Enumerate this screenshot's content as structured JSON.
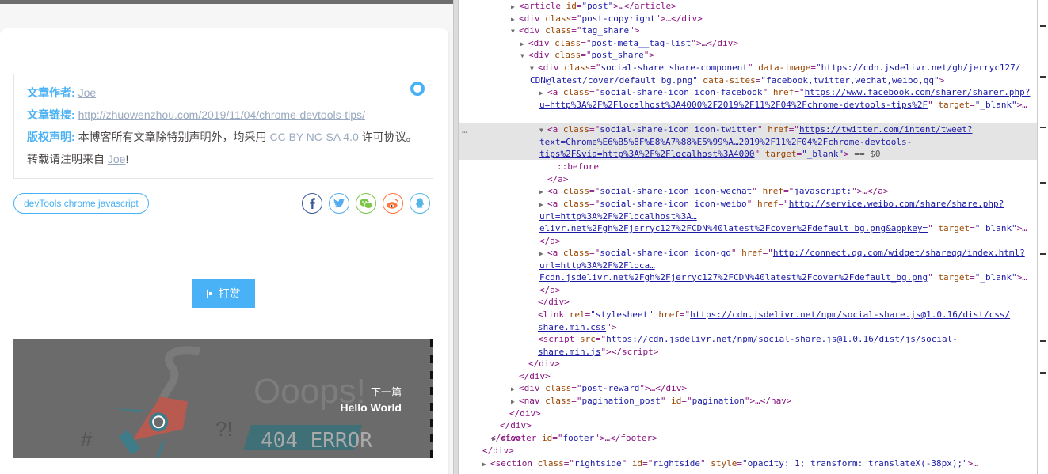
{
  "page": {
    "copyright": {
      "author_key": "文章作者:",
      "author_val": "Joe",
      "link_key": "文章链接:",
      "link_val": "http://zhuowenzhou.com/2019/11/04/chrome-devtools-tips/",
      "license_key": "版权声明:",
      "license_pre": "本博客所有文章除特别声明外，均采用",
      "license_link": "CC BY-NC-SA 4.0",
      "license_post": "许可协议。",
      "reprint_pre": "转载请注明来自",
      "reprint_link": "Joe",
      "reprint_post": "!"
    },
    "tags": "devTools chrome javascript",
    "share_icons": [
      {
        "name": "facebook-icon",
        "glyph": "f",
        "color": "#3b5998"
      },
      {
        "name": "twitter-icon",
        "glyph": "t",
        "color": "#55acee"
      },
      {
        "name": "wechat-icon",
        "glyph": "w",
        "color": "#7bc549"
      },
      {
        "name": "weibo-icon",
        "glyph": "w",
        "color": "#ff763b"
      },
      {
        "name": "qq-icon",
        "glyph": "q",
        "color": "#56b6e7"
      }
    ],
    "reward_label": "打赏",
    "next_label": "下一篇",
    "next_title": "Hello World",
    "cover_text_1": "Ooops!",
    "cover_text_2": "404 ERROR"
  },
  "devtools": {
    "l1": {
      "tag": "article",
      "attrs": "id=\"post\"",
      "tail": ">…</article>"
    },
    "l2": "post-copyright",
    "l3": "tag_share",
    "l4": "post-meta__tag-list",
    "l5": "post_share",
    "l6_cls": "social-share share-component",
    "l6_img_name": "data-image",
    "l6_img_val1": "\"https://cdn.jsdelivr.net/gh/jerryc127/",
    "l6_img_val2": "CDN@latest/cover/default_bg.png\"",
    "l6_sites_name": "data-sites",
    "l6_sites_val": "\"facebook,twitter,wechat,weibo,qq\"",
    "l7_cls": "social-share-icon icon-facebook",
    "l7_href1": "https://www.facebook.com/sharer/sharer.php?",
    "l7_href2": "u=http%3A%2F%2Flocalhost%3A4000%2F2019%2F11%2F04%2Fchrome-devtools-tips%2F",
    "l8_cls": "social-share-icon icon-twitter",
    "l8_href1": "https://twitter.com/intent/tweet?",
    "l8_href2": "text=Chrome%E6%B5%8F%E8%A7%88%E5%99%A…2019%2F11%2F04%2Fchrome-devtools-",
    "l8_href3": "tips%2F&via=http%3A%2F%2Flocalhost%3A4000",
    "l8_eq": "== $0",
    "before": "::before",
    "close_a": "</a>",
    "l9_cls": "social-share-icon icon-wechat",
    "l9_href": "javascript:",
    "l10_cls": "social-share-icon icon-weibo",
    "l10_href1": "http://service.weibo.com/share/share.php?",
    "l10_href2": "url=http%3A%2F%2Flocalhost%3A…",
    "l10_href3": "elivr.net%2Fgh%2Fjerryc127%2FCDN%40latest%2Fcover%2Fdefault_bg.png&appkey=",
    "l11_cls": "social-share-icon icon-qq",
    "l11_href1": "http://connect.qq.com/widget/shareqq/index.html?",
    "l11_href2": "url=http%3A%2F%2Floca…",
    "l11_href3": "Fcdn.jsdelivr.net%2Fgh%2Fjerryc127%2FCDN%40latest%2Fcover%2Fdefault_bg.png",
    "close_div": "</div>",
    "link_rel": "\"stylesheet\"",
    "link_href1": "https://cdn.jsdelivr.net/npm/social-share.js@1.0.16/dist/css/",
    "link_href2": "share.min.css",
    "script_src1": "https://cdn.jsdelivr.net/npm/social-share.js@1.0.16/dist/js/social-",
    "script_src2": "share.min.js",
    "reward_cls": "post-reward",
    "nav_cls": "pagination_post",
    "nav_id": "pagination",
    "footer_id": "footer",
    "section_cls": "rightside",
    "section_id": "rightside",
    "section_style": "\"opacity: 1; transform: translateX(-38px);\""
  }
}
